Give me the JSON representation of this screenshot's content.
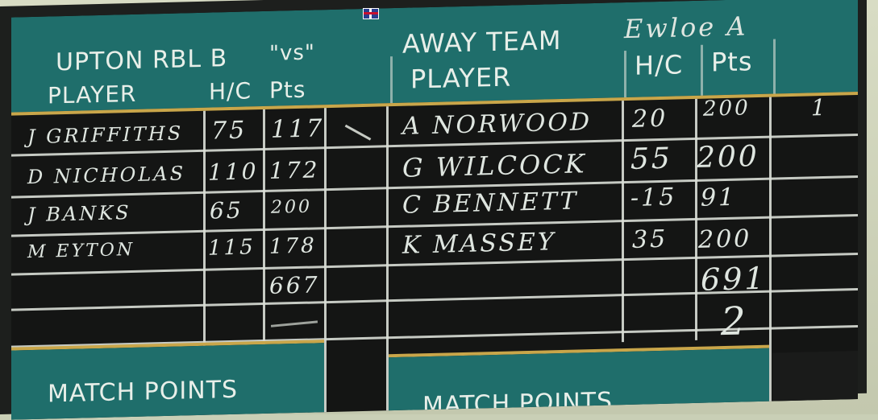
{
  "header": {
    "home_team": "UPTON RBL B",
    "vs": "\"vs\"",
    "away_label": "AWAY TEAM",
    "away_team": "Ewloe A"
  },
  "columns": {
    "player": "PLAYER",
    "hc": "H/C",
    "pts": "Pts"
  },
  "home_rows": [
    {
      "player": "J GRIFFITHS",
      "hc": "75",
      "pts": "117"
    },
    {
      "player": "D NICHOLAS",
      "hc": "110",
      "pts": "172"
    },
    {
      "player": "J BANKS",
      "hc": "65",
      "pts": "200"
    },
    {
      "player": "M EYTON",
      "hc": "115",
      "pts": "178"
    }
  ],
  "away_rows": [
    {
      "player": "A NORWOOD",
      "hc": "20",
      "pts": "200"
    },
    {
      "player": "G WILCOCK",
      "hc": "55",
      "pts": "200"
    },
    {
      "player": "C BENNETT",
      "hc": "-15",
      "pts": "91"
    },
    {
      "player": "K MASSEY",
      "hc": "35",
      "pts": "200"
    }
  ],
  "home_total": "667",
  "away_total": "691",
  "away_match_points": "2",
  "frame_mark": "1",
  "footer": {
    "match_points_left": "MATCH POINTS",
    "match_points_right": "MATCH POINTS"
  }
}
